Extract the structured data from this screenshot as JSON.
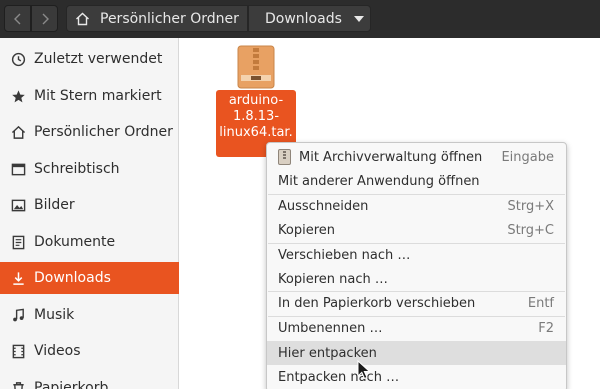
{
  "header": {
    "back_icon": "chevron-left-icon",
    "forward_icon": "chevron-right-icon",
    "breadcrumb": [
      {
        "label": "Persönlicher Ordner",
        "icon": "home-icon"
      },
      {
        "label": "Downloads",
        "icon": "caret-down-icon"
      }
    ]
  },
  "sidebar": {
    "items": [
      {
        "label": "Zuletzt verwendet",
        "icon": "clock-icon"
      },
      {
        "label": "Mit Stern markiert",
        "icon": "star-icon"
      },
      {
        "label": "Persönlicher Ordner",
        "icon": "home-icon"
      },
      {
        "label": "Schreibtisch",
        "icon": "desktop-icon"
      },
      {
        "label": "Bilder",
        "icon": "image-icon"
      },
      {
        "label": "Dokumente",
        "icon": "document-icon"
      },
      {
        "label": "Downloads",
        "icon": "download-icon",
        "active": true
      },
      {
        "label": "Musik",
        "icon": "music-icon"
      },
      {
        "label": "Videos",
        "icon": "video-icon"
      },
      {
        "label": "Papierkorb",
        "icon": "trash-icon"
      }
    ]
  },
  "file": {
    "name_line1": "arduino-",
    "name_line2": "1.8.13-",
    "name_line3": "linux64.tar.",
    "icon": "archive-icon"
  },
  "context_menu": {
    "items": [
      {
        "label": "Mit Archivverwaltung öffnen",
        "shortcut": "Eingabe",
        "icon": "archive-icon"
      },
      {
        "label": "Mit anderer Anwendung öffnen",
        "shortcut": ""
      },
      {
        "label": "Ausschneiden",
        "shortcut": "Strg+X"
      },
      {
        "label": "Kopieren",
        "shortcut": "Strg+C"
      },
      {
        "label": "Verschieben nach …",
        "shortcut": ""
      },
      {
        "label": "Kopieren nach …",
        "shortcut": ""
      },
      {
        "label": "In den Papierkorb verschieben",
        "shortcut": "Entf"
      },
      {
        "label": "Umbenennen …",
        "shortcut": "F2"
      },
      {
        "label": "Hier entpacken",
        "shortcut": "",
        "hovered": true
      },
      {
        "label": "Entpacken nach …",
        "shortcut": ""
      }
    ]
  },
  "colors": {
    "accent": "#e95420",
    "headerbar": "#2c2c2c",
    "sidebar": "#f5f5f5"
  }
}
